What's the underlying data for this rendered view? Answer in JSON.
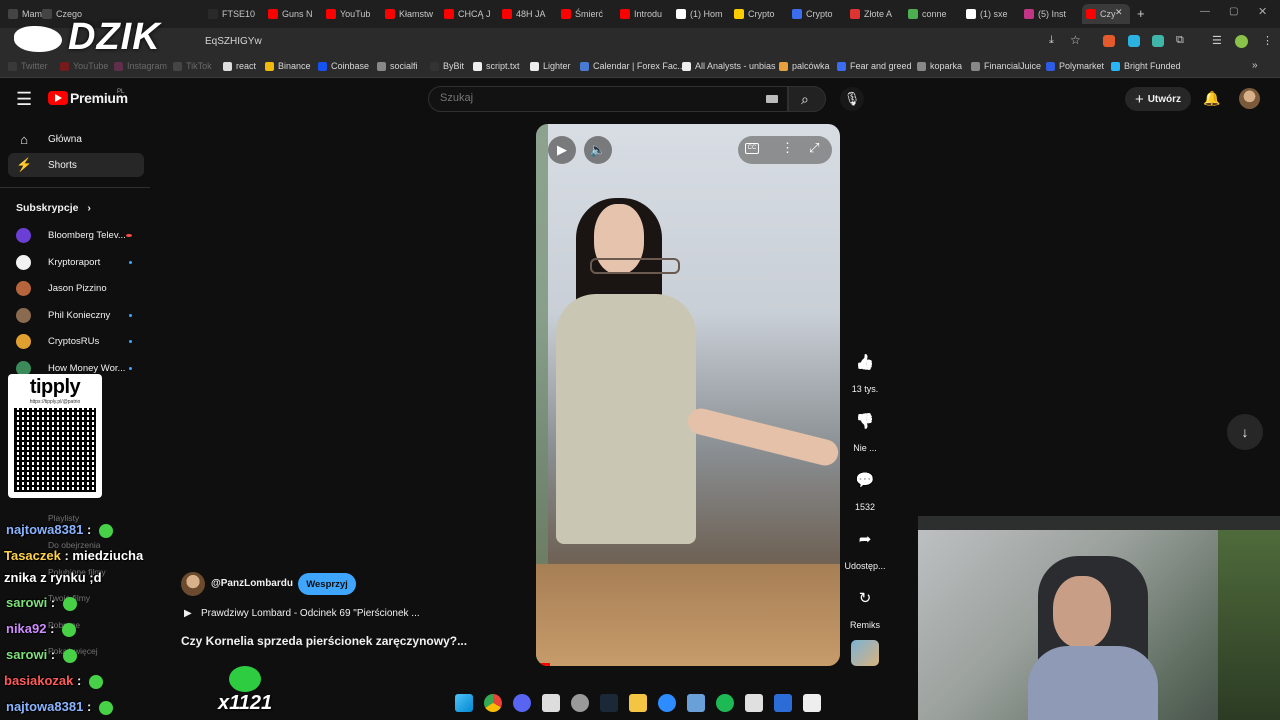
{
  "browser": {
    "tabs": [
      {
        "label": "Mama",
        "color": "#444"
      },
      {
        "label": "Czego",
        "color": "#444"
      },
      {
        "label": "FTSE10",
        "color": "#2a2a2a"
      },
      {
        "label": "Guns N",
        "color": "#ff0000"
      },
      {
        "label": "YouTub",
        "color": "#ff0000"
      },
      {
        "label": "Kłamstw",
        "color": "#ff0000"
      },
      {
        "label": "CHCĄ J",
        "color": "#ff0000"
      },
      {
        "label": "48H JA",
        "color": "#ff0000"
      },
      {
        "label": "Śmierć",
        "color": "#ff0000"
      },
      {
        "label": "Introdu",
        "color": "#ff0000"
      },
      {
        "label": "(1) Hom",
        "color": "#ffffff"
      },
      {
        "label": "Crypto",
        "color": "#ffcc00"
      },
      {
        "label": "Crypto",
        "color": "#3a6df0"
      },
      {
        "label": "Złote A",
        "color": "#d33"
      },
      {
        "label": "conne",
        "color": "#4caf50"
      },
      {
        "label": "(1) sxe",
        "color": "#ffffff"
      },
      {
        "label": "(5) Inst",
        "color": "#c13584"
      },
      {
        "label": "Czy",
        "color": "#ff0000"
      }
    ],
    "url": "EqSZHIGYw",
    "bookmarks": [
      {
        "label": "Twitter",
        "color": "#555"
      },
      {
        "label": "YouTube",
        "color": "#ff0000"
      },
      {
        "label": "Instagram",
        "color": "#c13584"
      },
      {
        "label": "TikTok",
        "color": "#777"
      },
      {
        "label": "react",
        "color": "#ddd"
      },
      {
        "label": "Binance",
        "color": "#f0b90b"
      },
      {
        "label": "Coinbase",
        "color": "#1652f0"
      },
      {
        "label": "socialfi",
        "color": "#888"
      },
      {
        "label": "ByBit",
        "color": "#333"
      },
      {
        "label": "script.txt",
        "color": "#eee"
      },
      {
        "label": "Lighter",
        "color": "#eee"
      },
      {
        "label": "Calendar | Forex Fac...",
        "color": "#4a7bd4"
      },
      {
        "label": "All Analysts - unbias",
        "color": "#eee"
      },
      {
        "label": "palcówka",
        "color": "#e8a03a"
      },
      {
        "label": "Fear and greed",
        "color": "#3a6df0"
      },
      {
        "label": "koparka",
        "color": "#888"
      },
      {
        "label": "FinancialJuice",
        "color": "#888"
      },
      {
        "label": "Polymarket",
        "color": "#2d5be3"
      },
      {
        "label": "Bright Funded",
        "color": "#29b6f6"
      }
    ]
  },
  "overlay": {
    "logo": "DZIK",
    "tipply_title": "tipply",
    "tipply_url": "https://tipply.pl/@patrio",
    "gift_count": "x1121"
  },
  "header": {
    "brand": "Premium",
    "brand_region": "PL",
    "search_placeholder": "Szukaj",
    "create_label": "Utwórz"
  },
  "sidebar": {
    "main": [
      {
        "label": "Główna",
        "icon": "home-icon"
      },
      {
        "label": "Shorts",
        "icon": "shorts-icon"
      }
    ],
    "subscriptions_title": "Subskrypcje",
    "subscriptions": [
      {
        "label": "Bloomberg Telev...",
        "color": "#6b3fd6",
        "live": true
      },
      {
        "label": "Kryptoraport",
        "color": "#f2f2f2",
        "dot": true
      },
      {
        "label": "Jason Pizzino",
        "color": "#b5643c",
        "dot": false
      },
      {
        "label": "Phil Konieczny",
        "color": "#8a6b4f",
        "dot": true
      },
      {
        "label": "CryptosRUs",
        "color": "#e0a030",
        "dot": true
      },
      {
        "label": "How Money Wor...",
        "color": "#3a8a5a",
        "dot": true
      }
    ],
    "you": [
      {
        "label": "Playlisty"
      },
      {
        "label": "Do obejrzenia"
      },
      {
        "label": "Polubione filmy"
      },
      {
        "label": "Twoje filmy"
      },
      {
        "label": "Pobrane"
      },
      {
        "label": "Pokaż więcej"
      }
    ]
  },
  "short": {
    "channel": "@PanzLombardu",
    "support_label": "Wesprzyj",
    "playlist": "Prawdziwy Lombard - Odcinek 69 \"Pierścionek ...",
    "title": "Czy Kornelia sprzeda pierścionek zaręczynowy?...",
    "actions": [
      {
        "icon": "thumbs-up-icon",
        "label": "13 tys."
      },
      {
        "icon": "thumbs-down-icon",
        "label": "Nie ..."
      },
      {
        "icon": "comments-icon",
        "label": "1532"
      },
      {
        "icon": "share-icon",
        "label": "Udostęp..."
      },
      {
        "icon": "remix-icon",
        "label": "Remiks"
      }
    ]
  },
  "chat": [
    {
      "user": "najtowa8381",
      "user_color": "#8ab4ff",
      "msg": "",
      "emote": true
    },
    {
      "user": "Tasaczek",
      "user_color": "#ffd24a",
      "msg": "miedziucha",
      "emote": false
    },
    {
      "user": "",
      "user_color": "#ffffff",
      "msg": "znika z rynku ;d",
      "emote": false
    },
    {
      "user": "sarowi",
      "user_color": "#7de07d",
      "msg": "",
      "emote": true
    },
    {
      "user": "nika92",
      "user_color": "#d08cff",
      "msg": "",
      "emote": true
    },
    {
      "user": "sarowi",
      "user_color": "#7de07d",
      "msg": "",
      "emote": true
    },
    {
      "user": "basiakozak",
      "user_color": "#ff5a5a",
      "msg": "",
      "emote": true
    },
    {
      "user": "najtowa8381",
      "user_color": "#8ab4ff",
      "msg": "",
      "emote": true
    }
  ],
  "colors": {
    "accent": "#3ea6ff",
    "yt_red": "#ff0000",
    "support_button": "#3ea6ff"
  }
}
